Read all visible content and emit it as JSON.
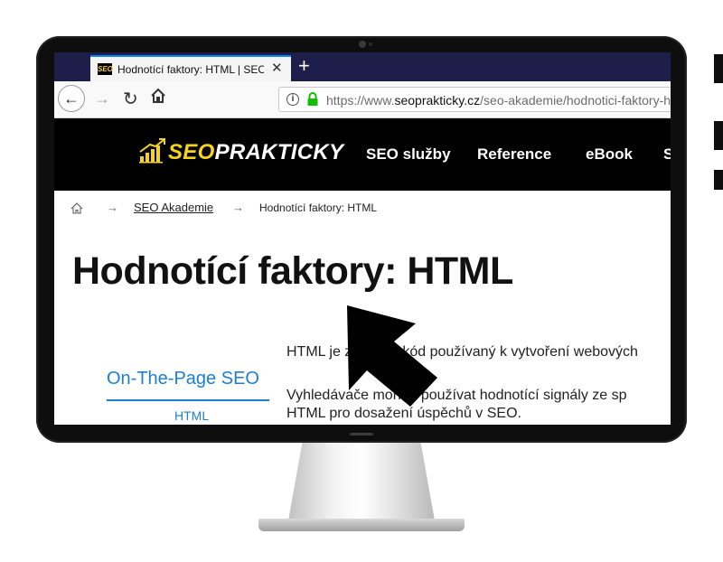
{
  "browser": {
    "tab_title": "Hodnotící faktory: HTML | SEO",
    "favicon_text": "SEO",
    "new_tab": "+",
    "tab_close": "✕",
    "url_prefix": "https://www.",
    "url_domain": "seoprakticky.cz",
    "url_path": "/seo-akademie/hodnotici-faktory-h"
  },
  "site": {
    "logo_part1": "SEO",
    "logo_part2": "PRAKTICKY",
    "nav": [
      "SEO služby",
      "Reference",
      "eBook",
      "S"
    ]
  },
  "breadcrumb": {
    "arrow": "→",
    "link": "SEO Akademie",
    "current": "Hodnotící faktory: HTML"
  },
  "page": {
    "title": "Hodnotící faktory: HTML",
    "sidebar_title": "On-The-Page SEO",
    "sidebar_item": "HTML",
    "para1_line1": "HTML je základní kód používaný k vytvoření webových",
    "para2_line1": "Vyhledávače mohou používat hodnotící signály ze sp",
    "para2_line2": "HTML pro dosažení úspěchů v SEO."
  },
  "colors": {
    "tabstrip": "#1e1e4a",
    "accent_blue": "#1c7fd0",
    "logo_yellow": "#f7d31a"
  }
}
